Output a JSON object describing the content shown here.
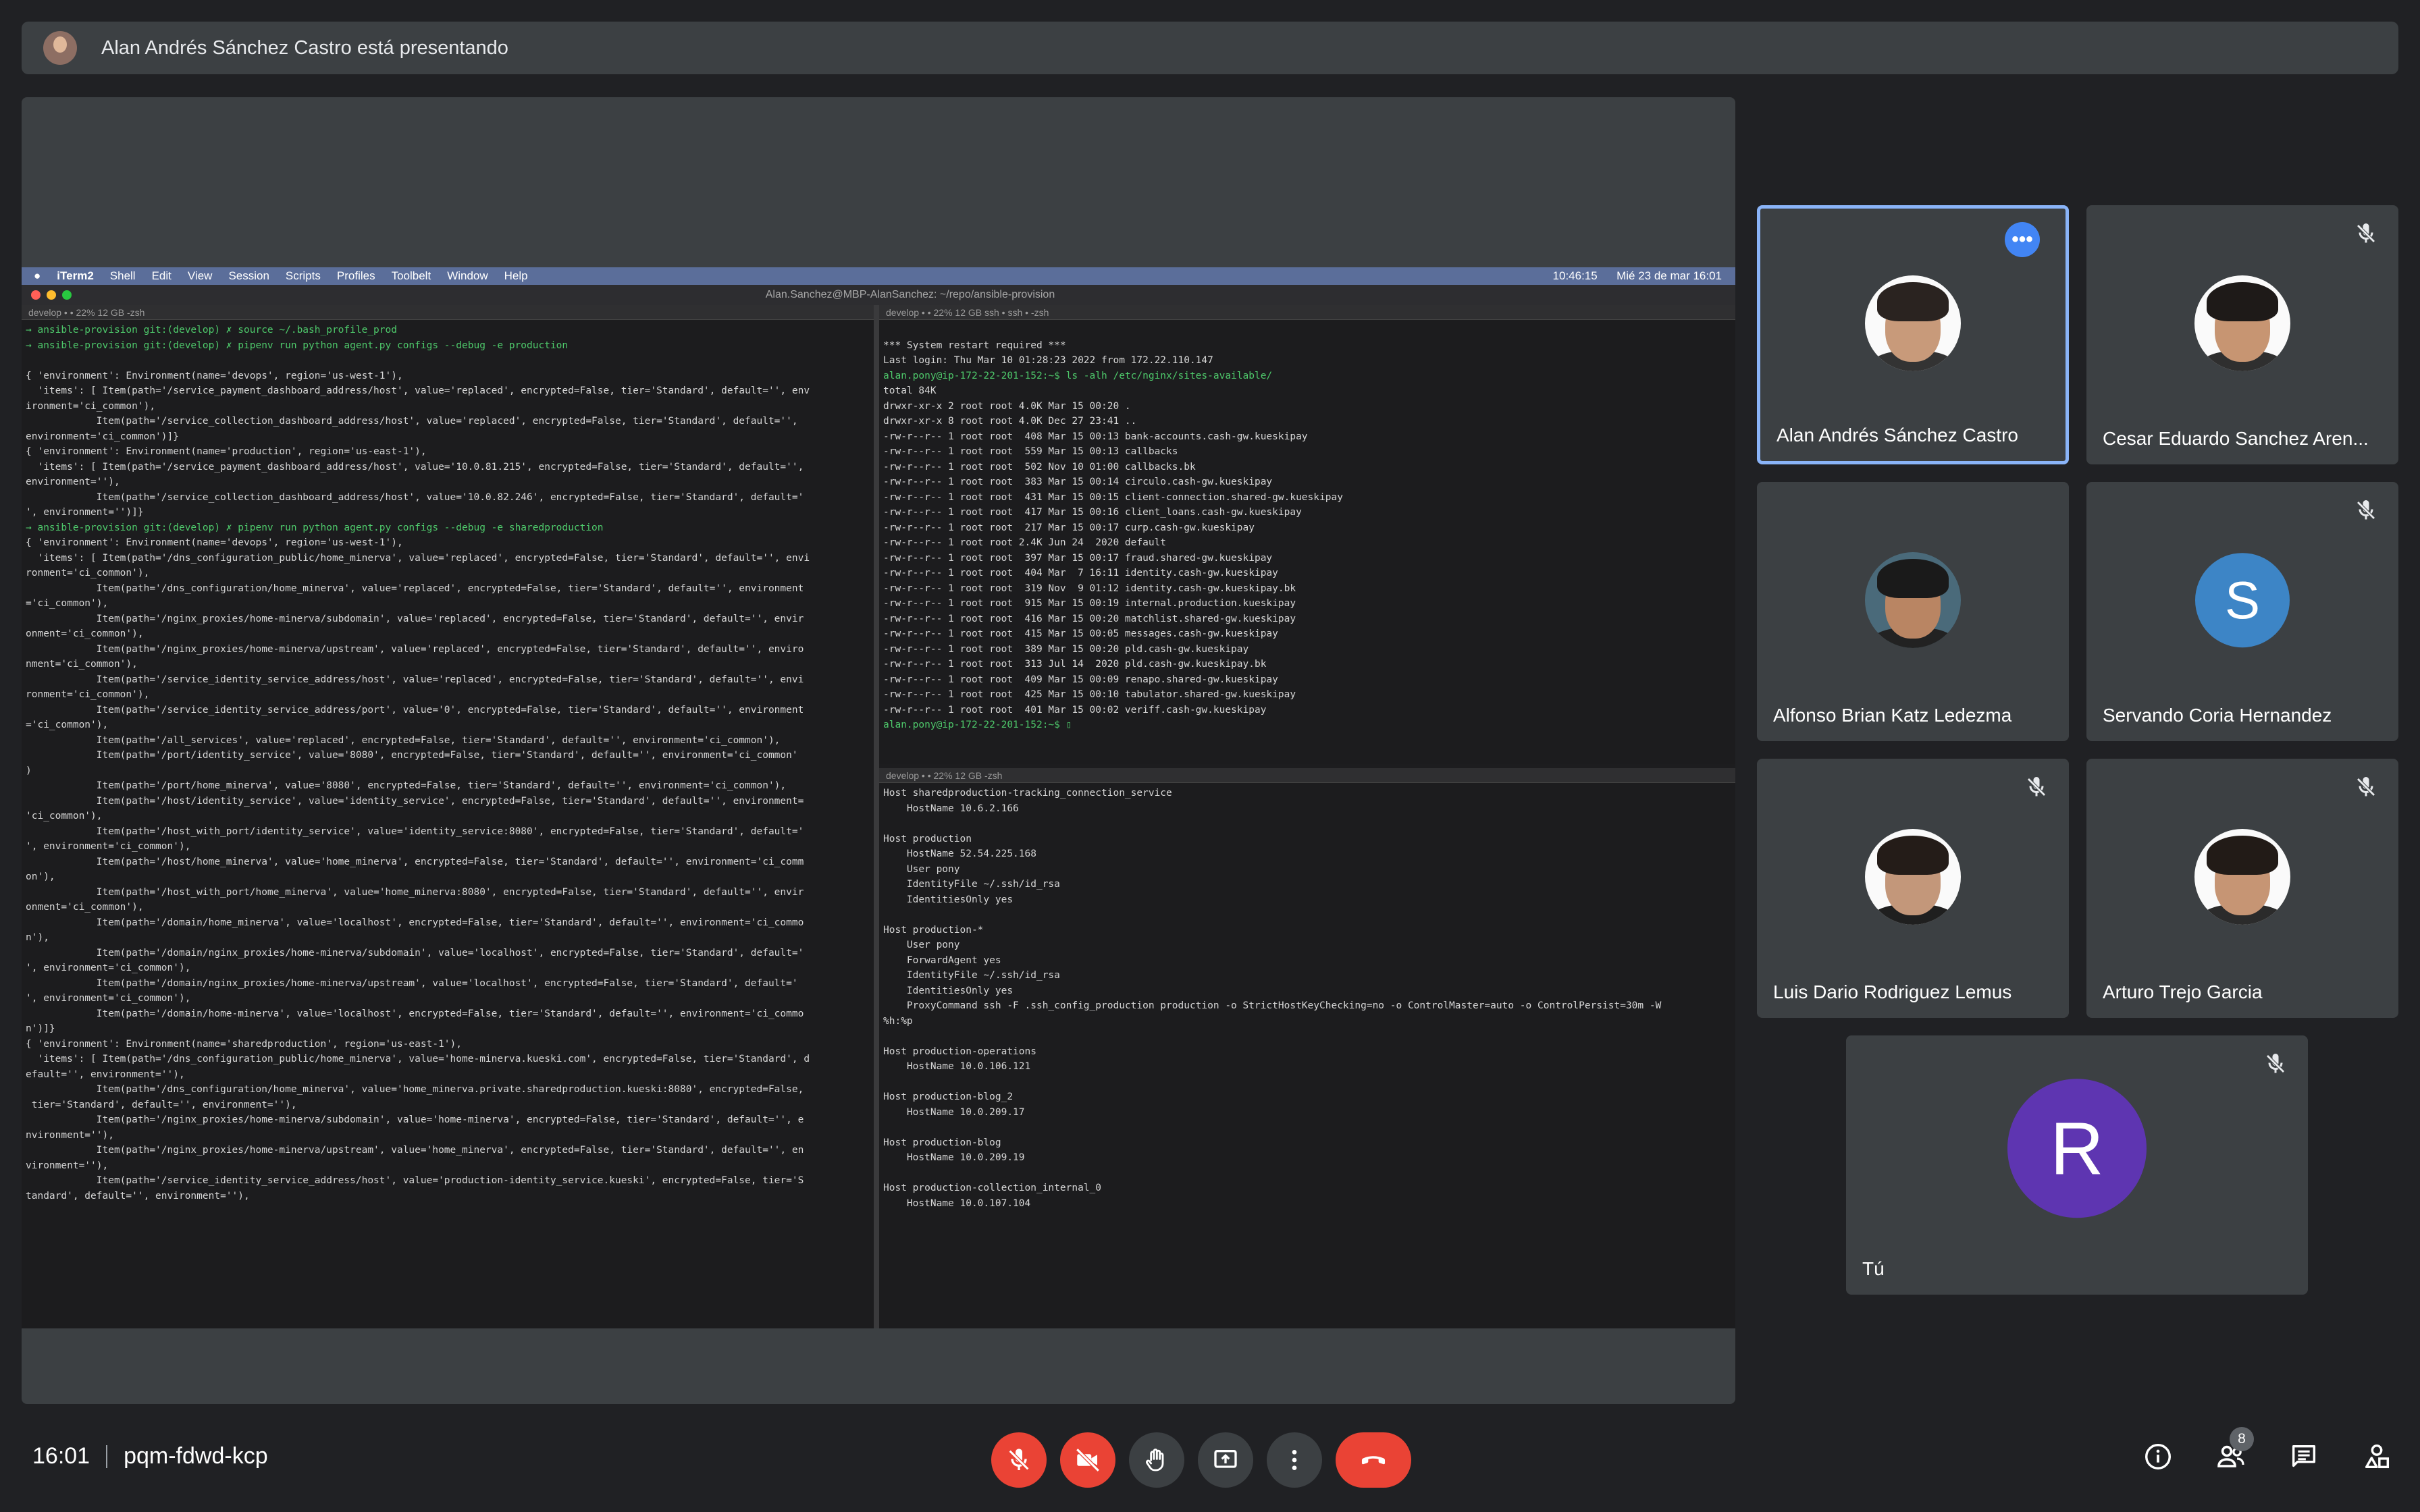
{
  "presenter_banner": {
    "text": "Alan Andrés Sánchez Castro está presentando"
  },
  "shared_screen": {
    "menu_bar": {
      "items": [
        "iTerm2",
        "Shell",
        "Edit",
        "View",
        "Session",
        "Scripts",
        "Profiles",
        "Toolbelt",
        "Window",
        "Help"
      ],
      "clock_small": "10:46:15",
      "datetime": "Mié 23 de mar  16:01"
    },
    "window_title": "Alan.Sanchez@MBP-AlanSanchez: ~/repo/ansible-provision",
    "left_pane": {
      "header": "develop • •     22%     12 GB     -zsh",
      "lines": [
        "→ ansible-provision git:(develop) ✗ source ~/.bash_profile_prod",
        "→ ansible-provision git:(develop) ✗ pipenv run python agent.py configs --debug -e production",
        "",
        "{ 'environment': Environment(name='devops', region='us-west-1'),",
        "  'items': [ Item(path='/service_payment_dashboard_address/host', value='replaced', encrypted=False, tier='Standard', default='', env",
        "ironment='ci_common'),",
        "            Item(path='/service_collection_dashboard_address/host', value='replaced', encrypted=False, tier='Standard', default='',",
        "environment='ci_common')]}",
        "{ 'environment': Environment(name='production', region='us-east-1'),",
        "  'items': [ Item(path='/service_payment_dashboard_address/host', value='10.0.81.215', encrypted=False, tier='Standard', default='',",
        "environment=''),",
        "            Item(path='/service_collection_dashboard_address/host', value='10.0.82.246', encrypted=False, tier='Standard', default='",
        "', environment='')]}",
        "→ ansible-provision git:(develop) ✗ pipenv run python agent.py configs --debug -e sharedproduction",
        "{ 'environment': Environment(name='devops', region='us-west-1'),",
        "  'items': [ Item(path='/dns_configuration_public/home_minerva', value='replaced', encrypted=False, tier='Standard', default='', envi",
        "ronment='ci_common'),",
        "            Item(path='/dns_configuration/home_minerva', value='replaced', encrypted=False, tier='Standard', default='', environment",
        "='ci_common'),",
        "            Item(path='/nginx_proxies/home-minerva/subdomain', value='replaced', encrypted=False, tier='Standard', default='', envir",
        "onment='ci_common'),",
        "            Item(path='/nginx_proxies/home-minerva/upstream', value='replaced', encrypted=False, tier='Standard', default='', enviro",
        "nment='ci_common'),",
        "            Item(path='/service_identity_service_address/host', value='replaced', encrypted=False, tier='Standard', default='', envi",
        "ronment='ci_common'),",
        "            Item(path='/service_identity_service_address/port', value='0', encrypted=False, tier='Standard', default='', environment",
        "='ci_common'),",
        "            Item(path='/all_services', value='replaced', encrypted=False, tier='Standard', default='', environment='ci_common'),",
        "            Item(path='/port/identity_service', value='8080', encrypted=False, tier='Standard', default='', environment='ci_common'",
        ")",
        "            Item(path='/port/home_minerva', value='8080', encrypted=False, tier='Standard', default='', environment='ci_common'),",
        "            Item(path='/host/identity_service', value='identity_service', encrypted=False, tier='Standard', default='', environment=",
        "'ci_common'),",
        "            Item(path='/host_with_port/identity_service', value='identity_service:8080', encrypted=False, tier='Standard', default='",
        "', environment='ci_common'),",
        "            Item(path='/host/home_minerva', value='home_minerva', encrypted=False, tier='Standard', default='', environment='ci_comm",
        "on'),",
        "            Item(path='/host_with_port/home_minerva', value='home_minerva:8080', encrypted=False, tier='Standard', default='', envir",
        "onment='ci_common'),",
        "            Item(path='/domain/home_minerva', value='localhost', encrypted=False, tier='Standard', default='', environment='ci_commo",
        "n'),",
        "            Item(path='/domain/nginx_proxies/home-minerva/subdomain', value='localhost', encrypted=False, tier='Standard', default='",
        "', environment='ci_common'),",
        "            Item(path='/domain/nginx_proxies/home-minerva/upstream', value='localhost', encrypted=False, tier='Standard', default='",
        "', environment='ci_common'),",
        "            Item(path='/domain/home-minerva', value='localhost', encrypted=False, tier='Standard', default='', environment='ci_commo",
        "n')]}",
        "{ 'environment': Environment(name='sharedproduction', region='us-east-1'),",
        "  'items': [ Item(path='/dns_configuration_public/home_minerva', value='home-minerva.kueski.com', encrypted=False, tier='Standard', d",
        "efault='', environment=''),",
        "            Item(path='/dns_configuration/home_minerva', value='home_minerva.private.sharedproduction.kueski:8080', encrypted=False,",
        " tier='Standard', default='', environment=''),",
        "            Item(path='/nginx_proxies/home-minerva/subdomain', value='home-minerva', encrypted=False, tier='Standard', default='', e",
        "nvironment=''),",
        "            Item(path='/nginx_proxies/home-minerva/upstream', value='home_minerva', encrypted=False, tier='Standard', default='', en",
        "vironment=''),",
        "            Item(path='/service_identity_service_address/host', value='production-identity_service.kueski', encrypted=False, tier='S",
        "tandard', default='', environment=''),"
      ]
    },
    "right_top_pane": {
      "header": "develop • •     22%     12 GB     ssh • ssh • -zsh",
      "lines": [
        "",
        "*** System restart required ***",
        "Last login: Thu Mar 10 01:28:23 2022 from 172.22.110.147",
        "alan.pony@ip-172-22-201-152:~$ ls -alh /etc/nginx/sites-available/",
        "total 84K",
        "drwxr-xr-x 2 root root 4.0K Mar 15 00:20 .",
        "drwxr-xr-x 8 root root 4.0K Dec 27 23:41 ..",
        "-rw-r--r-- 1 root root  408 Mar 15 00:13 bank-accounts.cash-gw.kueskipay",
        "-rw-r--r-- 1 root root  559 Mar 15 00:13 callbacks",
        "-rw-r--r-- 1 root root  502 Nov 10 01:00 callbacks.bk",
        "-rw-r--r-- 1 root root  383 Mar 15 00:14 circulo.cash-gw.kueskipay",
        "-rw-r--r-- 1 root root  431 Mar 15 00:15 client-connection.shared-gw.kueskipay",
        "-rw-r--r-- 1 root root  417 Mar 15 00:16 client_loans.cash-gw.kueskipay",
        "-rw-r--r-- 1 root root  217 Mar 15 00:17 curp.cash-gw.kueskipay",
        "-rw-r--r-- 1 root root 2.4K Jun 24  2020 default",
        "-rw-r--r-- 1 root root  397 Mar 15 00:17 fraud.shared-gw.kueskipay",
        "-rw-r--r-- 1 root root  404 Mar  7 16:11 identity.cash-gw.kueskipay",
        "-rw-r--r-- 1 root root  319 Nov  9 01:12 identity.cash-gw.kueskipay.bk",
        "-rw-r--r-- 1 root root  915 Mar 15 00:19 internal.production.kueskipay",
        "-rw-r--r-- 1 root root  416 Mar 15 00:20 matchlist.shared-gw.kueskipay",
        "-rw-r--r-- 1 root root  415 Mar 15 00:05 messages.cash-gw.kueskipay",
        "-rw-r--r-- 1 root root  389 Mar 15 00:20 pld.cash-gw.kueskipay",
        "-rw-r--r-- 1 root root  313 Jul 14  2020 pld.cash-gw.kueskipay.bk",
        "-rw-r--r-- 1 root root  409 Mar 15 00:09 renapo.shared-gw.kueskipay",
        "-rw-r--r-- 1 root root  425 Mar 15 00:10 tabulator.shared-gw.kueskipay",
        "-rw-r--r-- 1 root root  401 Mar 15 00:02 veriff.cash-gw.kueskipay",
        "alan.pony@ip-172-22-201-152:~$ ▯"
      ]
    },
    "right_bottom_pane": {
      "header": "develop • •     22%     12 GB     -zsh",
      "lines": [
        "Host sharedproduction-tracking_connection_service",
        "    HostName 10.6.2.166",
        "",
        "Host production",
        "    HostName 52.54.225.168",
        "    User pony",
        "    IdentityFile ~/.ssh/id_rsa",
        "    IdentitiesOnly yes",
        "",
        "Host production-*",
        "    User pony",
        "    ForwardAgent yes",
        "    IdentityFile ~/.ssh/id_rsa",
        "    IdentitiesOnly yes",
        "    ProxyCommand ssh -F .ssh_config_production production -o StrictHostKeyChecking=no -o ControlMaster=auto -o ControlPersist=30m -W",
        "%h:%p",
        "",
        "Host production-operations",
        "    HostName 10.0.106.121",
        "",
        "Host production-blog_2",
        "    HostName 10.0.209.17",
        "",
        "Host production-blog",
        "    HostName 10.0.209.19",
        "",
        "Host production-collection_internal_0",
        "    HostName 10.0.107.104"
      ]
    }
  },
  "participants": [
    {
      "name": "Alan Andrés Sánchez Castro",
      "muted": false,
      "active": true
    },
    {
      "name": "Cesar Eduardo Sanchez Aren...",
      "muted": true
    },
    {
      "name": "Alfonso Brian Katz Ledezma",
      "muted": false
    },
    {
      "name": "Servando Coria Hernandez",
      "muted": true,
      "initial": "S",
      "color": "#3d85c6"
    },
    {
      "name": "Luis Dario Rodriguez Lemus",
      "muted": true
    },
    {
      "name": "Arturo Trejo Garcia",
      "muted": true
    },
    {
      "name": "Tú",
      "muted": true,
      "initial": "R",
      "color": "#5e35b1"
    }
  ],
  "footer": {
    "time": "16:01",
    "meeting_code": "pqm-fdwd-kcp",
    "participant_count": "8"
  },
  "colors": {
    "mic_off": "#ea4335",
    "active_border": "#8ab4f8",
    "background": "#202124",
    "tile": "#3c4043"
  }
}
